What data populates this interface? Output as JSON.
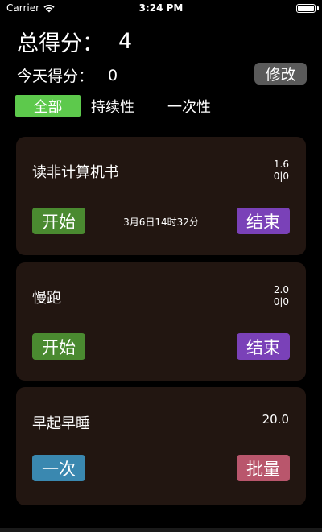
{
  "status_bar": {
    "carrier": "Carrier",
    "time": "3:24 PM",
    "battery_level": 1.0
  },
  "header": {
    "total_label": "总得分：",
    "total_value": "4",
    "today_label": "今天得分：",
    "today_value": "0",
    "edit_label": "修改"
  },
  "tabs": [
    {
      "label": "全部",
      "active": true
    },
    {
      "label": "持续性",
      "active": false
    },
    {
      "label": "一次性",
      "active": false
    }
  ],
  "cards": [
    {
      "title": "读非计算机书",
      "score": "1.6",
      "counts": "0|0",
      "start_label": "开始",
      "end_label": "结束",
      "time_text": "3月6日14时32分"
    },
    {
      "title": "慢跑",
      "score": "2.0",
      "counts": "0|0",
      "start_label": "开始",
      "end_label": "结束"
    },
    {
      "title": "早起早睡",
      "score": "20.0",
      "once_label": "一次",
      "batch_label": "批量"
    }
  ],
  "colors": {
    "accent_green": "#5dc94c",
    "start_green": "#4a8a30",
    "end_purple": "#7a41b8",
    "once_blue": "#3a88b0",
    "batch_pink": "#b9566c",
    "card_bg": "#221611"
  }
}
